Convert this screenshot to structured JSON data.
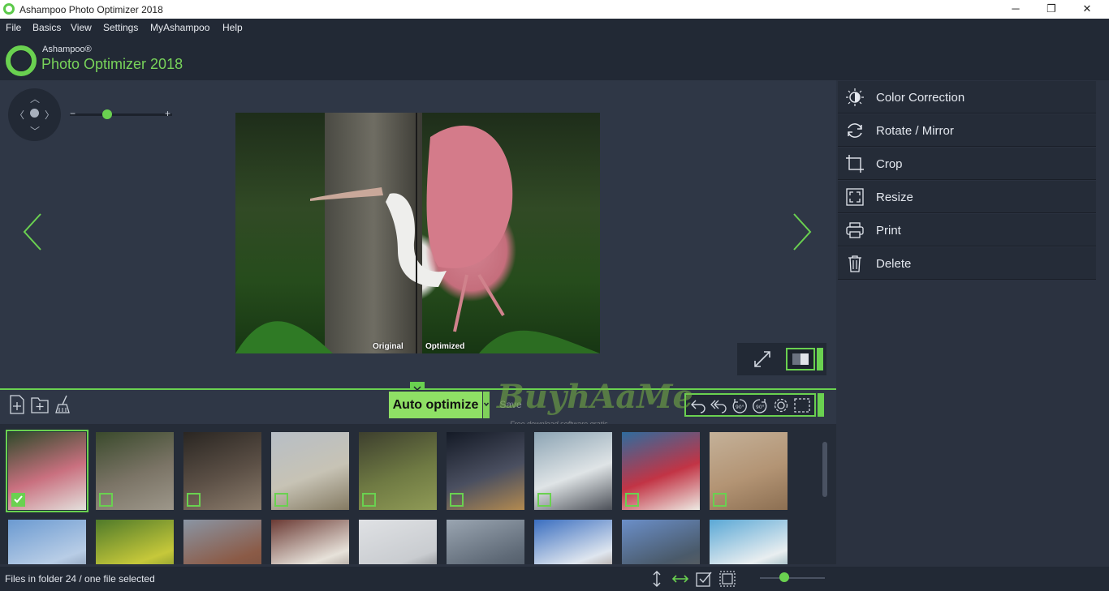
{
  "window": {
    "title": "Ashampoo Photo Optimizer 2018",
    "minimize": "─",
    "maximize": "❐",
    "close": "✕"
  },
  "menu": [
    "File",
    "Basics",
    "View",
    "Settings",
    "MyAshampoo",
    "Help"
  ],
  "logo": {
    "small": "Ashampoo®",
    "big": "Photo Optimizer 2018"
  },
  "zoom": {
    "minus": "−",
    "plus": "+",
    "level": 0.35
  },
  "viewer": {
    "label_original": "Original",
    "label_optimized": "Optimized"
  },
  "tools": [
    {
      "icon": "color-correction-icon",
      "label": "Color Correction"
    },
    {
      "icon": "rotate-icon",
      "label": "Rotate / Mirror"
    },
    {
      "icon": "crop-icon",
      "label": "Crop"
    },
    {
      "icon": "resize-icon",
      "label": "Resize"
    },
    {
      "icon": "print-icon",
      "label": "Print"
    },
    {
      "icon": "trash-icon",
      "label": "Delete"
    }
  ],
  "toolbar": {
    "auto_optimize": "Auto optimize",
    "save": "Save"
  },
  "watermark": {
    "main": "BuyhAaMe",
    "sub": "Free download software gratis"
  },
  "status": {
    "text": "Files in folder 24 / one file selected",
    "thumb_size": 0.35
  },
  "thumbnails": [
    {
      "colors": [
        "#2f4a2a",
        "#c9707f",
        "#e3e0dc"
      ],
      "selected": true
    },
    {
      "colors": [
        "#3a4a2c",
        "#7b7466",
        "#9d978a"
      ],
      "selected": false
    },
    {
      "colors": [
        "#2a2622",
        "#5c5046",
        "#8a7b6b"
      ],
      "selected": false
    },
    {
      "colors": [
        "#b7bec6",
        "#c7c3b5",
        "#847a62"
      ],
      "selected": false
    },
    {
      "colors": [
        "#3d3f2e",
        "#6f7a43",
        "#8f9a56"
      ],
      "selected": false
    },
    {
      "colors": [
        "#141a26",
        "#4a4f60",
        "#b38a50"
      ],
      "selected": false
    },
    {
      "colors": [
        "#8ca4b4",
        "#dfe4e6",
        "#4c5058"
      ],
      "selected": false
    },
    {
      "colors": [
        "#2f6c9e",
        "#c23445",
        "#edeae3"
      ],
      "selected": false
    },
    {
      "colors": [
        "#c4b199",
        "#b39474",
        "#8c6f52"
      ],
      "selected": false
    },
    {
      "colors": [
        "#6b9ad1",
        "#b8cde6",
        "#54627a"
      ],
      "selected": false
    },
    {
      "colors": [
        "#4f7a2a",
        "#c6c83a",
        "#3c5e22"
      ],
      "selected": false
    },
    {
      "colors": [
        "#8a95a4",
        "#8b5b47",
        "#6b4738"
      ],
      "selected": false
    },
    {
      "colors": [
        "#6b3a34",
        "#e7e2da",
        "#5a4a44"
      ],
      "selected": false
    },
    {
      "colors": [
        "#dfe1e4",
        "#c9ccd0",
        "#3a3d42"
      ],
      "selected": false
    },
    {
      "colors": [
        "#9aa5b1",
        "#5f6a77",
        "#3d4652"
      ],
      "selected": false
    },
    {
      "colors": [
        "#3a6ec0",
        "#dfe6ef",
        "#6a4a30"
      ],
      "selected": false
    },
    {
      "colors": [
        "#6b8fc9",
        "#4a5a6a",
        "#6f6151"
      ],
      "selected": false
    },
    {
      "colors": [
        "#5aa8d6",
        "#e9eef0",
        "#2a6a7a"
      ],
      "selected": false
    }
  ]
}
